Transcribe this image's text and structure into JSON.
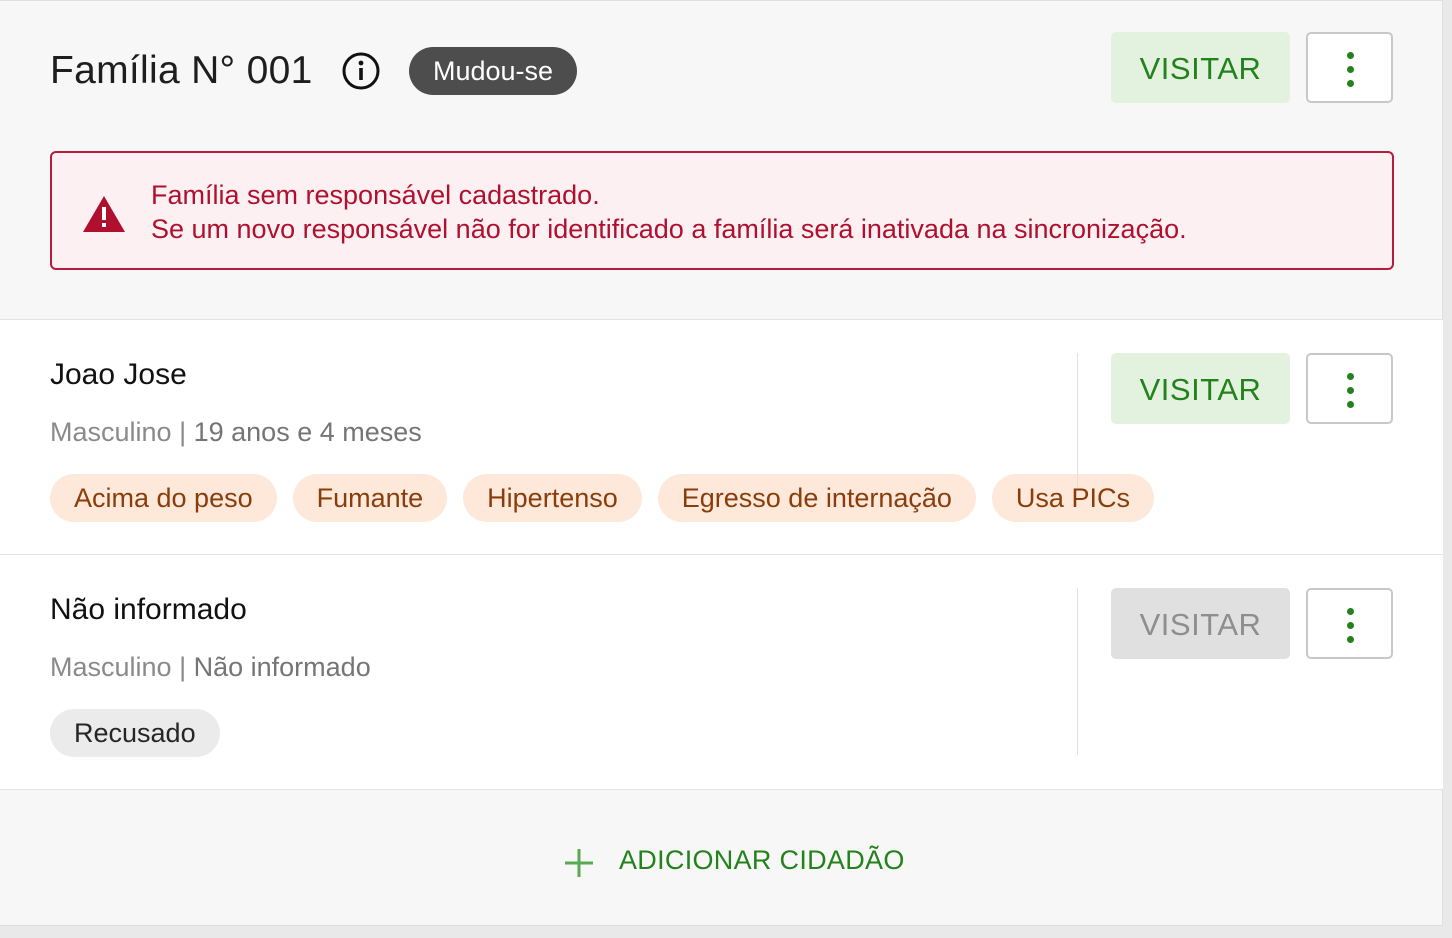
{
  "family": {
    "title": "Família N° 001",
    "status_badge": "Mudou-se",
    "visit_label": "VISITAR",
    "alert": {
      "line1": "Família sem responsável cadastrado.",
      "line2": "Se um novo responsável não for identificado a família será inativada na sincronização."
    }
  },
  "members": [
    {
      "name": "Joao Jose",
      "gender": "Masculino",
      "separator": "|",
      "age": "19 anos e 4 meses",
      "visit_label": "VISITAR",
      "visit_enabled": true,
      "tags": [
        "Acima do peso",
        "Fumante",
        "Hipertenso",
        "Egresso de internação",
        "Usa PICs"
      ]
    },
    {
      "name": "Não informado",
      "gender": "Masculino",
      "separator": "|",
      "age": "Não informado",
      "visit_label": "VISITAR",
      "visit_enabled": false,
      "tags": [
        "Recusado"
      ]
    }
  ],
  "footer": {
    "add_label": "ADICIONAR CIDADÃO"
  },
  "colors": {
    "accent_green": "#23821b",
    "visit_bg": "#e3f2de",
    "alert_red": "#b0102f",
    "tag_bg": "#fde8da",
    "tag_text": "#8a3d0a",
    "badge_bg": "#4d4d4d"
  },
  "icons": {
    "info": "info-circle-icon",
    "more": "more-vertical-icon",
    "alert": "warning-triangle-icon",
    "add": "plus-icon"
  }
}
